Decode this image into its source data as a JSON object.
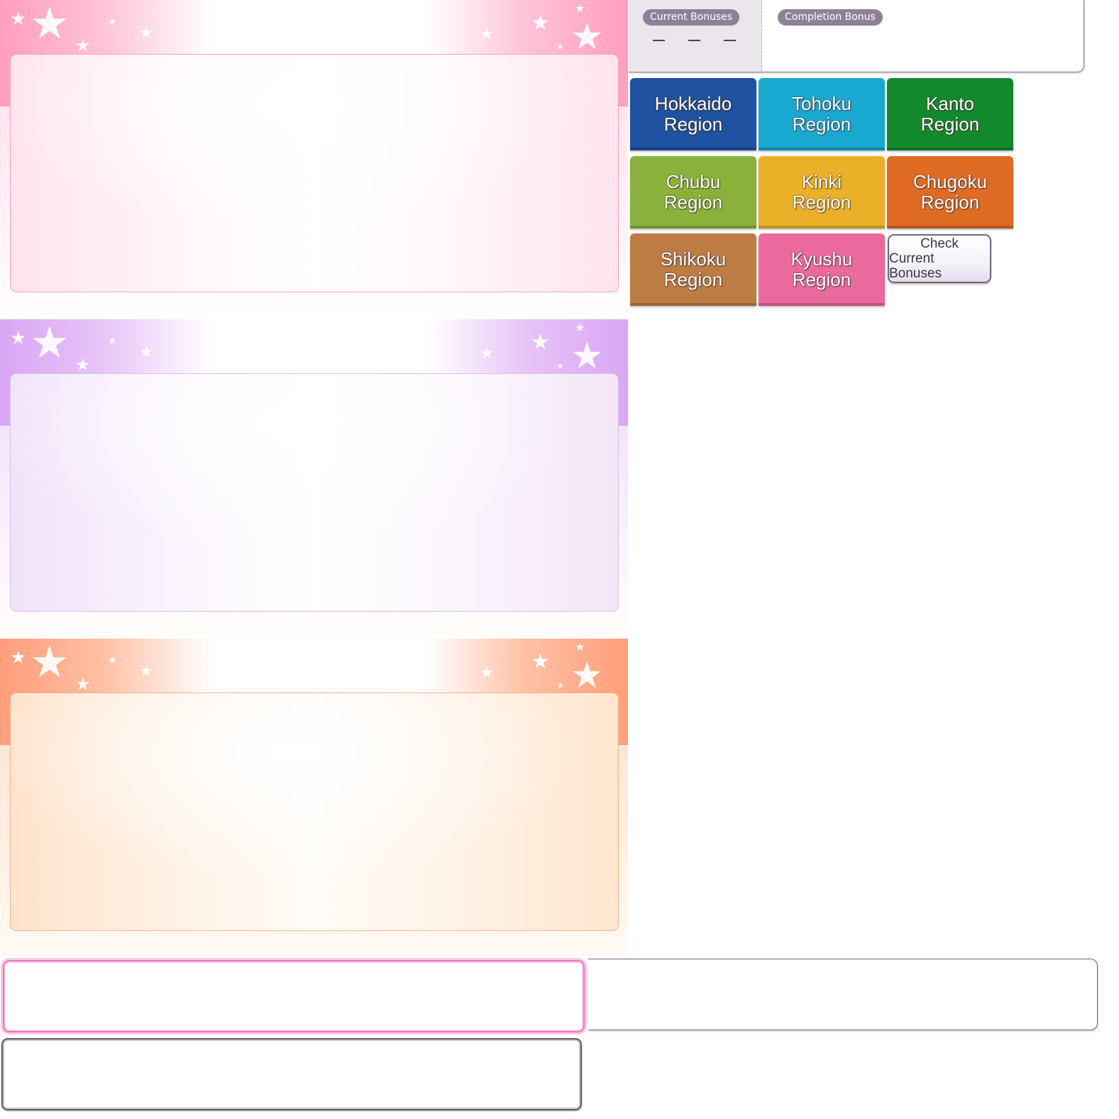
{
  "bonus_header": {
    "current_bonuses_label": "Current Bonuses",
    "completion_bonus_label": "Completion Bonus",
    "current_values": [
      "–",
      "–",
      "–"
    ]
  },
  "regions": [
    {
      "name": "Hokkaido",
      "suffix": "Region",
      "color": "#1f52a0"
    },
    {
      "name": "Tohoku",
      "suffix": "Region",
      "color": "#19a8d0"
    },
    {
      "name": "Kanto",
      "suffix": "Region",
      "color": "#128a2c"
    },
    {
      "name": "Chubu",
      "suffix": "Region",
      "color": "#8ab23a"
    },
    {
      "name": "Kinki",
      "suffix": "Region",
      "color": "#eab028"
    },
    {
      "name": "Chugoku",
      "suffix": "Region",
      "color": "#e06b22"
    },
    {
      "name": "Shikoku",
      "suffix": "Region",
      "color": "#bd7c44"
    },
    {
      "name": "Kyushu",
      "suffix": "Region",
      "color": "#ea6a9e"
    }
  ],
  "check_button": {
    "line1": "Check",
    "line2": "Current Bonuses"
  },
  "theme_colors": {
    "pink": "#ff9fbd",
    "purple": "#d9a6f5",
    "orange": "#ff9d7a"
  }
}
